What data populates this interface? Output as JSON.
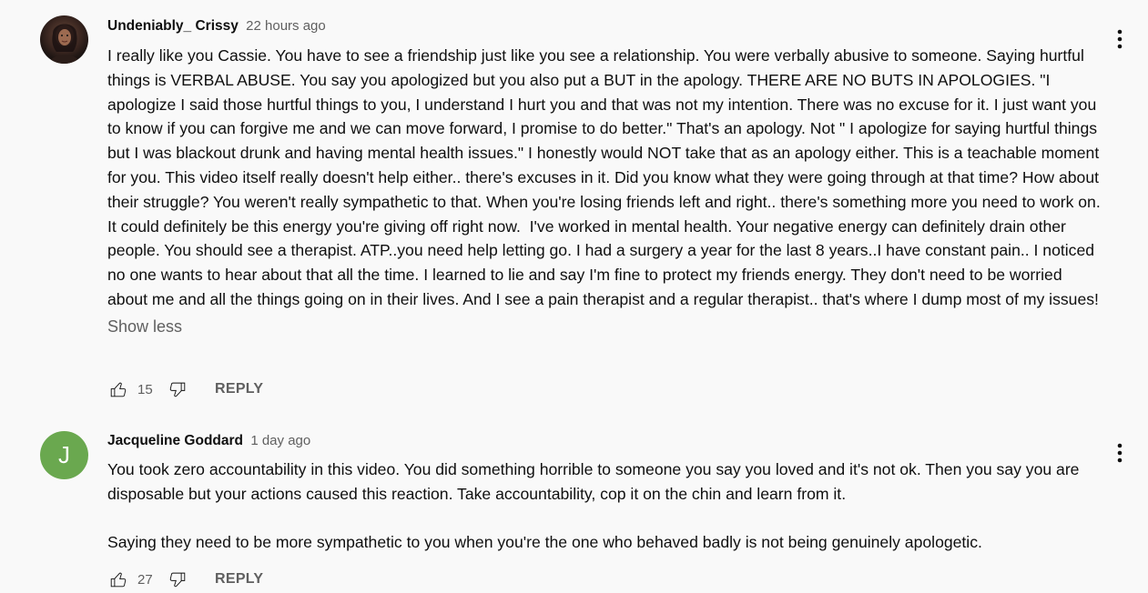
{
  "comments": [
    {
      "author": "Undeniably_ Crissy",
      "time": "22 hours ago",
      "avatar_type": "photo",
      "text": "I really like you Cassie. You have to see a friendship just like you see a relationship. You were verbally abusive to someone. Saying hurtful things is VERBAL ABUSE. You say you apologized but you also put a BUT in the apology. THERE ARE NO BUTS IN APOLOGIES. \"I apologize I said those hurtful things to you, I understand I hurt you and that was not my intention. There was no excuse for it. I just want you to know if you can forgive me and we can move forward, I promise to do better.\" That's an apology. Not \" I apologize for saying hurtful things but I was blackout drunk and having mental health issues.\" I honestly would NOT take that as an apology either. This is a teachable moment for you. This video itself really doesn't help either.. there's excuses in it. Did you know what they were going through at that time? How about their struggle? You weren't really sympathetic to that. When you're losing friends left and right.. there's something more you need to work on. It could definitely be this energy you're giving off right now.  I've worked in mental health. Your negative energy can definitely drain other people. You should see a therapist. ATP..you need help letting go. I had a surgery a year for the last 8 years..I have constant pain.. I noticed no one wants to hear about that all the time. I learned to lie and say I'm fine to protect my friends energy. They don't need to be worried about me and all the things going on in their lives. And I see a pain therapist and a regular therapist.. that's where I dump most of my issues!",
      "show_less": "Show less",
      "likes": "15",
      "reply": "REPLY"
    },
    {
      "author": "Jacqueline Goddard",
      "time": "1 day ago",
      "avatar_type": "letter",
      "avatar_letter": "J",
      "avatar_color": "#6aa84f",
      "text": "You took zero accountability in this video. You did something horrible to someone you say you loved and it's not ok. Then you say you are disposable but your actions caused this reaction. Take accountability, cop it on the chin and learn from it.\n\nSaying they need to be more sympathetic to you when you're the one who behaved badly is not being genuinely apologetic.",
      "likes": "27",
      "reply": "REPLY"
    }
  ],
  "icons": {
    "like": "thumb-up-icon",
    "dislike": "thumb-down-icon",
    "menu": "more-vert-icon"
  }
}
